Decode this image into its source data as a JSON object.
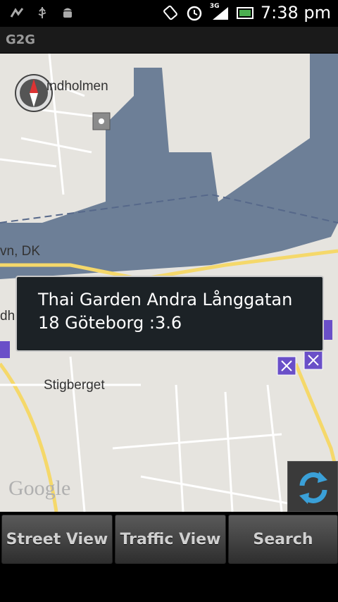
{
  "status_bar": {
    "time": "7:38 pm",
    "icons_left": [
      "signal-bars-icon",
      "usb-icon",
      "android-debug-icon"
    ],
    "icons_right": [
      "rotate-icon",
      "alarm-icon",
      "network-3g-icon",
      "battery-icon"
    ],
    "network_label": "3G"
  },
  "app": {
    "title": "G2G"
  },
  "map": {
    "labels": {
      "lindholmen": "indholmen",
      "ferry": "vn, DK",
      "left_edge": "dh",
      "stigberget": "Stigberget"
    },
    "logo": "Google"
  },
  "popup": {
    "text": "Thai Garden Andra Långgatan 18  Göteborg :3.6"
  },
  "bottom_bar": {
    "street_view": "Street View",
    "traffic_view": "Traffic View",
    "search": "Search"
  }
}
